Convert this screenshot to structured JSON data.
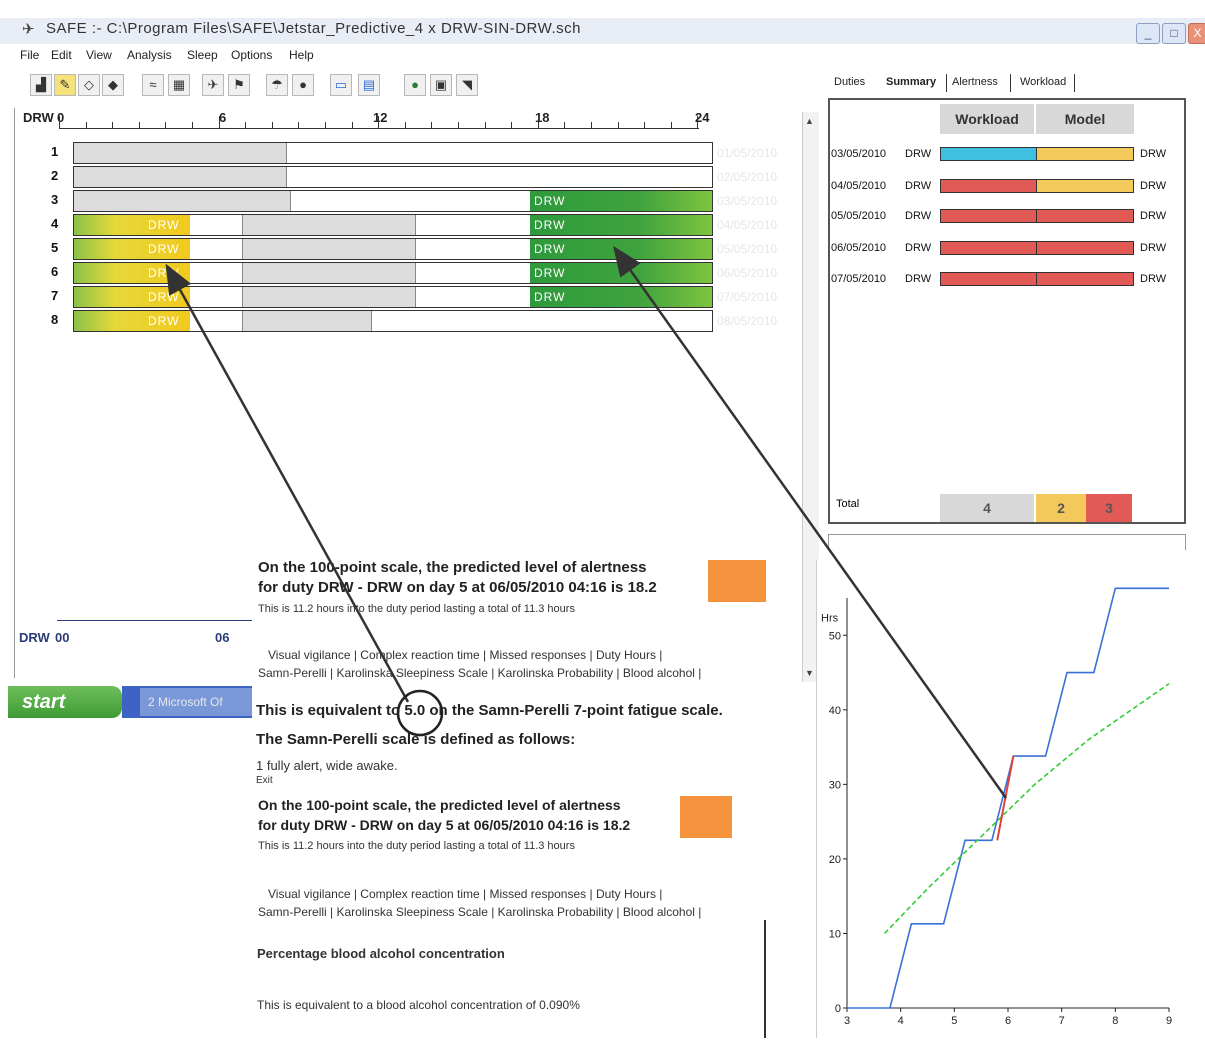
{
  "window": {
    "title": "SAFE :- C:\\Program Files\\SAFE\\Jetstar_Predictive_4 x DRW-SIN-DRW.sch",
    "min": "_",
    "max": "□",
    "close": "X"
  },
  "menu": [
    "File",
    "Edit",
    "View",
    "Analysis",
    "Sleep",
    "Options",
    "Help"
  ],
  "toolbar_icons": [
    "bar-chart-icon",
    "pencil-icon",
    "eraser-icon",
    "paint-icon",
    "wave-icon",
    "sheet-icon",
    "plane-icon",
    "flag-icon",
    "sleep-icon",
    "moon-icon",
    "monitor-icon",
    "grid-icon",
    "globe-icon",
    "suitcase-icon",
    "tail-icon"
  ],
  "schedule": {
    "ruler_prefix": "DRW",
    "ruler_labels": [
      "0",
      "6",
      "12",
      "18",
      "24"
    ],
    "rows": [
      {
        "n": "1",
        "date": "01/05/2010",
        "yellow": "",
        "green": ""
      },
      {
        "n": "2",
        "date": "02/05/2010",
        "yellow": "",
        "green": ""
      },
      {
        "n": "3",
        "date": "03/05/2010",
        "yellow": "",
        "green": "DRW"
      },
      {
        "n": "4",
        "date": "04/05/2010",
        "yellow": "DRW",
        "green": "DRW"
      },
      {
        "n": "5",
        "date": "05/05/2010",
        "yellow": "DRW",
        "green": "DRW"
      },
      {
        "n": "6",
        "date": "06/05/2010",
        "yellow": "DRW",
        "green": "DRW"
      },
      {
        "n": "7",
        "date": "07/05/2010",
        "yellow": "DRW",
        "green": "DRW"
      },
      {
        "n": "8",
        "date": "08/05/2010",
        "yellow": "DRW",
        "green": ""
      }
    ],
    "lower_ruler_prefix": "DRW",
    "lower_ruler_labels": [
      "00",
      "06"
    ]
  },
  "taskbar": {
    "start": "start",
    "item": "2 Microsoft Of"
  },
  "right_tabs": [
    "Duties",
    "Summary",
    "Alertness",
    "Workload"
  ],
  "summary": {
    "col_workload": "Workload",
    "col_model": "Model",
    "rows": [
      {
        "date": "03/05/2010",
        "from": "DRW",
        "to": "DRW",
        "left_color": "#40c0e0",
        "right_color": "#f2c95a"
      },
      {
        "date": "04/05/2010",
        "from": "DRW",
        "to": "DRW",
        "left_color": "#e25a55",
        "right_color": "#f2c95a"
      },
      {
        "date": "05/05/2010",
        "from": "DRW",
        "to": "DRW",
        "left_color": "#e25a55",
        "right_color": "#e25a55"
      },
      {
        "date": "06/05/2010",
        "from": "DRW",
        "to": "DRW",
        "left_color": "#e25a55",
        "right_color": "#e25a55"
      },
      {
        "date": "07/05/2010",
        "from": "DRW",
        "to": "DRW",
        "left_color": "#e25a55",
        "right_color": "#e25a55"
      }
    ],
    "total_label": "Total",
    "totals": [
      "4",
      "2",
      "3"
    ]
  },
  "popup1": {
    "line1": "On the 100-point scale, the predicted level of alertness",
    "line2": "for duty DRW - DRW on day 5 at 06/05/2010 04:16 is 18.2",
    "sub": "This is 11.2 hours into the duty period lasting a total of 11.3 hours",
    "tabs_row1": "Visual vigilance  |  Complex reaction time  |  Missed responses |  Duty Hours |",
    "tabs_row2": "Samn-Perelli  |  Karolinska Sleepiness Scale |  Karolinska Probability  |  Blood alcohol |",
    "equiv_pre": "This is equivalent to ",
    "equiv_val": "5.0",
    "equiv_post": " on the Samn-Perelli 7-point fatigue scale.",
    "defined": "The Samn-Perelli scale is defined as follows:",
    "scale1": "1 fully alert, wide awake.",
    "exit": "Exit"
  },
  "popup2": {
    "line1": "On the 100-point scale, the predicted level of alertness",
    "line2": "for duty DRW - DRW on day 5 at 06/05/2010 04:16 is 18.2",
    "sub": "This is 11.2 hours into the duty period lasting a total of 11.3 hours",
    "tabs_row1": "Visual vigilance  |  Complex reaction time  |  Missed responses |  Duty Hours |",
    "tabs_row2": "Samn-Perelli  |  Karolinska Sleepiness Scale |  Karolinska Probability  |  Blood alcohol |",
    "heading": "Percentage blood alcohol concentration",
    "text": "This is equivalent to a blood alcohol concentration of 0.090%"
  },
  "chart_data": {
    "type": "line",
    "ylabel": "Hrs",
    "xlim": [
      3,
      9
    ],
    "ylim": [
      0,
      55
    ],
    "x_ticks": [
      "3",
      "4",
      "5",
      "6",
      "7",
      "8",
      "9"
    ],
    "y_ticks": [
      "0",
      "10",
      "20",
      "30",
      "40",
      "50"
    ],
    "series": [
      {
        "color": "#3b6fd8",
        "points": [
          [
            3.0,
            0
          ],
          [
            3.8,
            0
          ],
          [
            4.2,
            11.3
          ],
          [
            4.8,
            11.3
          ],
          [
            5.2,
            22.5
          ],
          [
            5.7,
            22.5
          ],
          [
            6.1,
            33.8
          ],
          [
            6.7,
            33.8
          ],
          [
            7.1,
            45
          ],
          [
            7.6,
            45
          ],
          [
            8.0,
            56.3
          ],
          [
            9.0,
            56.3
          ]
        ]
      },
      {
        "color": "#33cc33",
        "dashed": true,
        "points": [
          [
            3.7,
            10
          ],
          [
            4.5,
            16
          ],
          [
            5.5,
            23
          ],
          [
            6.5,
            30
          ],
          [
            7.5,
            36
          ],
          [
            8.5,
            41
          ],
          [
            9.0,
            43.5
          ]
        ]
      }
    ],
    "highlight": {
      "color": "#e04040",
      "points": [
        [
          5.8,
          22.5
        ],
        [
          6.1,
          33.8
        ]
      ]
    }
  }
}
